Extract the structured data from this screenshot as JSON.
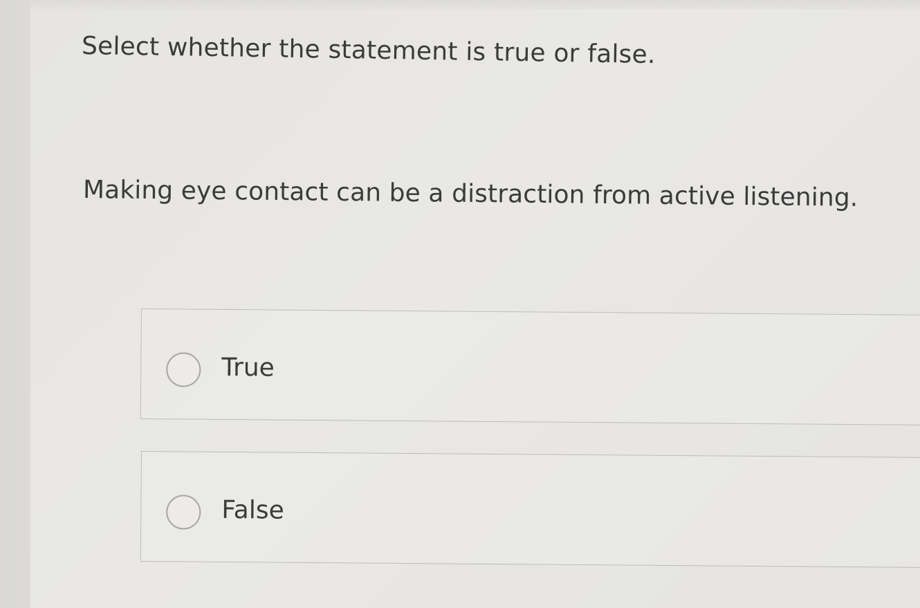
{
  "question": {
    "instruction": "Select whether the statement is true or false.",
    "statement": "Making eye contact can be a distraction from active listening."
  },
  "options": [
    {
      "label": "True",
      "selected": false
    },
    {
      "label": "False",
      "selected": false
    }
  ],
  "colors": {
    "background": "#e4e3e0",
    "text": "#3b3b3b",
    "border": "#bdbcb8",
    "radio_border": "#a6a5a2"
  }
}
